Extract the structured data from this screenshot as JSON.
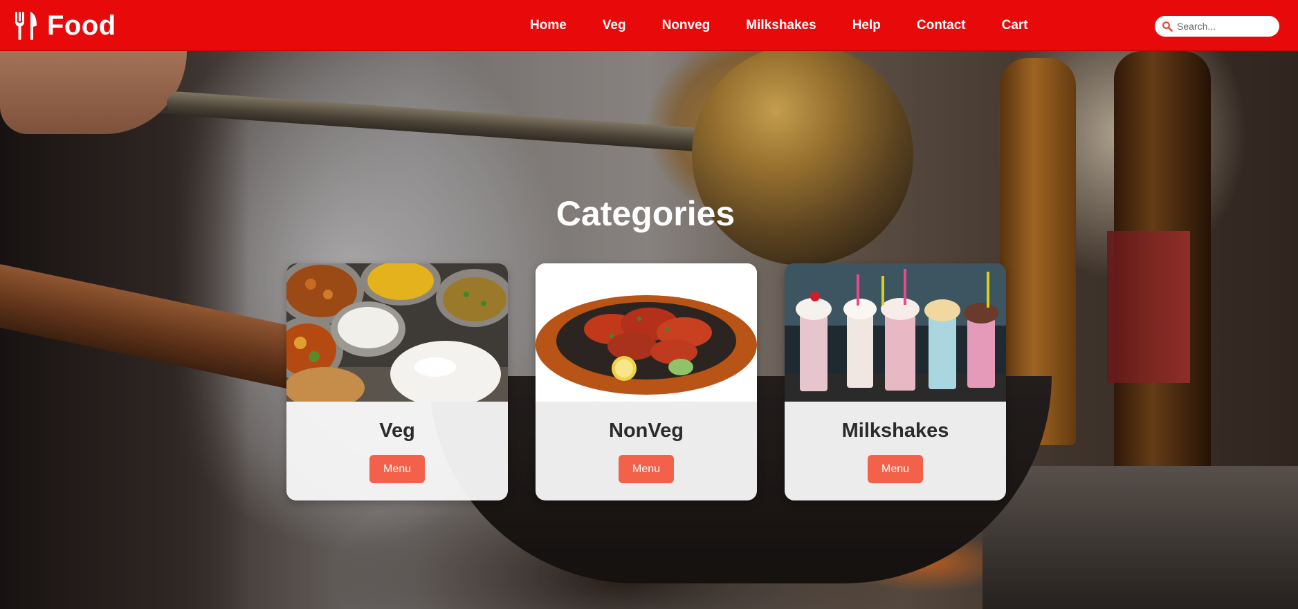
{
  "brand": {
    "name": "Food",
    "icon": "fork-knife-icon"
  },
  "nav": {
    "links": [
      "Home",
      "Veg",
      "Nonveg",
      "Milkshakes",
      "Help",
      "Contact",
      "Cart"
    ]
  },
  "search": {
    "placeholder": "Search...",
    "value": "",
    "icon": "search-icon"
  },
  "main": {
    "title": "Categories",
    "cards": [
      {
        "title": "Veg",
        "image": "veg-thali-image",
        "button_label": "Menu"
      },
      {
        "title": "NonVeg",
        "image": "tandoori-platter-image",
        "button_label": "Menu"
      },
      {
        "title": "Milkshakes",
        "image": "milkshake-glasses-image",
        "button_label": "Menu"
      }
    ]
  },
  "colors": {
    "header_bg": "#e8090b",
    "button_bg": "#f4614a",
    "card_bg": "#f8f8f8",
    "text_dark": "#2b2b2b",
    "text_light": "#ffffff"
  }
}
